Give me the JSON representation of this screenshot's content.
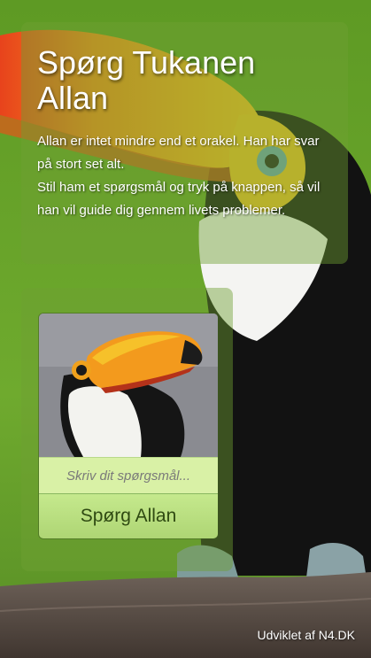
{
  "intro": {
    "title": "Spørg Tukanen Allan",
    "description_line1": "Allan er intet mindre end et orakel. Han har svar på stort set alt.",
    "description_line2": "Stil ham et spørgsmål og tryk på knappen, så vil han vil guide dig gennem livets problemer."
  },
  "ask": {
    "input_placeholder": "Skriv dit spørgsmål...",
    "button_label": "Spørg Allan"
  },
  "footer": {
    "credit": "Udviklet af N4.DK"
  },
  "colors": {
    "background_green": "#6aa52a",
    "input_bg": "#d9f1a6",
    "button_bg": "#bde283",
    "button_text": "#2f4a12"
  }
}
